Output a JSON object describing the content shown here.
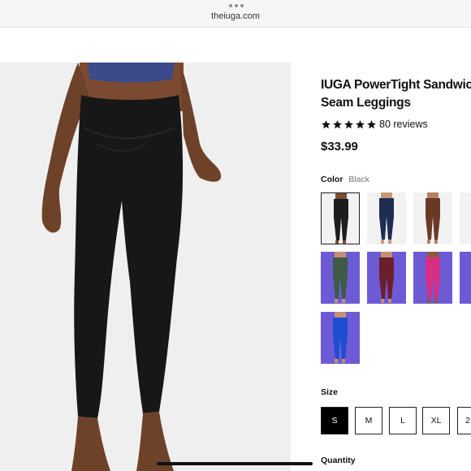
{
  "browser": {
    "url": "theiuga.com"
  },
  "product": {
    "title": "IUGA PowerTight Sandwich\nSeam Leggings",
    "rating": 5,
    "reviews_text": "80 reviews",
    "price": "$33.99"
  },
  "color": {
    "label": "Color",
    "selected": "Black",
    "swatches": [
      {
        "name": "Black",
        "bg": "#f2f2f2",
        "fill": "#1d1d1d",
        "skin": "#7a4e33"
      },
      {
        "name": "Navy",
        "bg": "#f2f2f2",
        "fill": "#1f2d55",
        "skin": "#c99a7a"
      },
      {
        "name": "Brown",
        "bg": "#f2f2f2",
        "fill": "#6a3a27",
        "skin": "#b58163"
      },
      {
        "name": "Partial",
        "bg": "#f2f2f2",
        "fill": "#6b6b6b",
        "skin": "#d2a48a"
      },
      {
        "name": "Green",
        "bg": "#6d5bd6",
        "fill": "#3f5a45",
        "skin": "#c49070"
      },
      {
        "name": "Wine",
        "bg": "#6d5bd6",
        "fill": "#6b1f2b",
        "skin": "#c49070"
      },
      {
        "name": "Pink",
        "bg": "#6d5bd6",
        "fill": "#d72f86",
        "skin": "#8a5a3e"
      },
      {
        "name": "Partial2",
        "bg": "#6d5bd6",
        "fill": "#7a7a7a",
        "skin": "#c49070"
      },
      {
        "name": "Royal Blue",
        "bg": "#6d5bd6",
        "fill": "#1f4dd0",
        "skin": "#c49070"
      }
    ]
  },
  "size": {
    "label": "Size",
    "options": [
      "S",
      "M",
      "L",
      "XL",
      "2"
    ],
    "selected": "S"
  },
  "quantity": {
    "label": "Quantity"
  }
}
